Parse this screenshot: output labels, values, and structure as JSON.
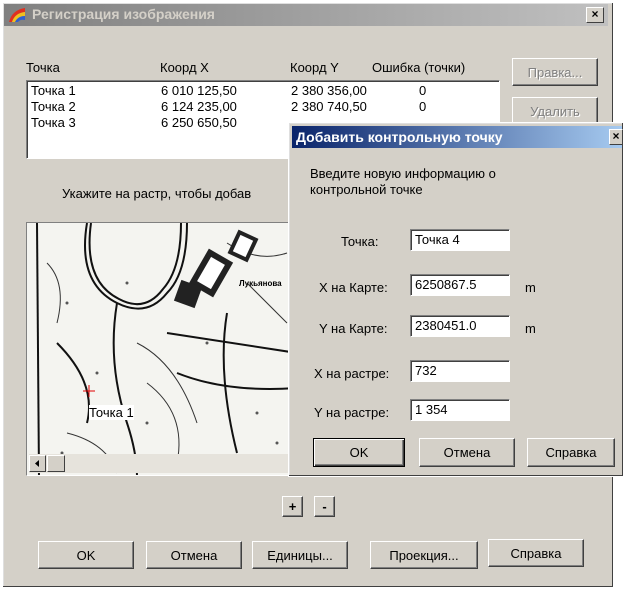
{
  "window": {
    "title": "Регистрация изображения",
    "close_label": "×"
  },
  "list": {
    "headers": {
      "point": "Точка",
      "x": "Коорд X",
      "y": "Коорд Y",
      "err": "Ошибка (точки)"
    },
    "rows": [
      {
        "point": "Точка 1",
        "x": "6 010 125,50",
        "y": "2 380 356,00",
        "err": "0"
      },
      {
        "point": "Точка 2",
        "x": "6 124 235,00",
        "y": "2 380 740,50",
        "err": "0"
      },
      {
        "point": "Точка 3",
        "x": "6 250 650,50",
        "y": "",
        "err": ""
      }
    ]
  },
  "side_buttons": {
    "edit": "Правка...",
    "delete": "Удалить"
  },
  "hint": "Укажите на растр, чтобы добав",
  "raster": {
    "point_label": "Точка 1",
    "map_label": "Лукьянова"
  },
  "zoom": {
    "plus": "+",
    "minus": "-"
  },
  "bottom_buttons": {
    "ok": "OK",
    "cancel": "Отмена",
    "units": "Единицы...",
    "projection": "Проекция...",
    "help": "Справка"
  },
  "dialog": {
    "title": "Добавить контрольную точку",
    "close_label": "×",
    "prompt_line1": "Введите новую информацию о",
    "prompt_line2": "контрольной точке",
    "point_label": "Точка:",
    "point_value": "Точка 4",
    "mapx_label": "X на Карте:",
    "mapx_value": "6250867.5",
    "mapx_unit": "m",
    "mapy_label": "Y на Карте:",
    "mapy_value": "2380451.0",
    "mapy_unit": "m",
    "rasterx_label": "X на растре:",
    "rasterx_value": "732",
    "rastery_label": "Y на растре:",
    "rastery_value": "1 354",
    "ok": "OK",
    "cancel": "Отмена",
    "help": "Справка"
  }
}
